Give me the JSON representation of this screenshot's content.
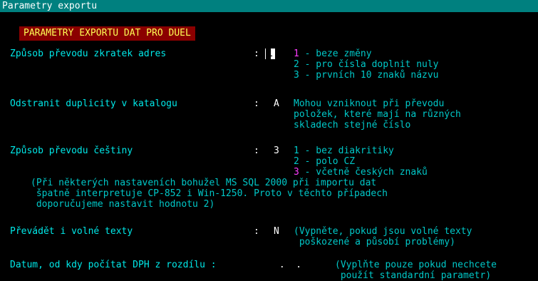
{
  "window": {
    "title": "Parametry exportu"
  },
  "heading": "PARAMETRY EXPORTU DAT PRO DUEL",
  "settings": {
    "addresses": {
      "label": "Způsob převodu zkratek adres",
      "colon": ":",
      "value": "1",
      "options": [
        {
          "num": "1",
          "text": " - beze změny"
        },
        {
          "num": "2",
          "text": " - pro čísla doplnit nuly"
        },
        {
          "num": "3",
          "text": " - prvních 10 znaků názvu"
        }
      ]
    },
    "duplicates": {
      "label": "Odstranit duplicity v katalogu",
      "colon": ":",
      "value": "A",
      "help": [
        "Mohou vzniknout při převodu",
        "položek, které mají na různých",
        "skladech stejné číslo"
      ]
    },
    "czech": {
      "label": "Způsob převodu češtiny",
      "colon": ":",
      "value": "3",
      "options": [
        {
          "num": "1",
          "text": " - bez diakritiky"
        },
        {
          "num": "2",
          "text": " - polo CZ"
        },
        {
          "num": "3",
          "text": " - včetně českých znaků"
        }
      ],
      "note": [
        "(Při některých nastaveních bohužel MS SQL 2000 při importu dat",
        " špatně interpretuje CP-852 i Win-1250. Proto v těchto případech",
        " doporučujeme nastavit hodnotu 2)"
      ]
    },
    "free_texts": {
      "label": "Převádět i volné texty",
      "colon": ":",
      "value": "N",
      "help": [
        "(Vypněte, pokud jsou volné texty",
        " poškozené a působí problémy)"
      ]
    },
    "vat_date": {
      "label": "Datum, od kdy počítat DPH z rozdílu :",
      "value": " .  .",
      "help": [
        "(Vyplňte pouze pokud nechcete",
        " použít standardní parametr)"
      ]
    }
  },
  "colors": {
    "background": "#000000",
    "titlebar": "#00807f",
    "text_cyan": "#00c8c8",
    "heading_bg": "#8b0000",
    "heading_fg": "#ffff55",
    "highlight": "#ff3cff"
  }
}
